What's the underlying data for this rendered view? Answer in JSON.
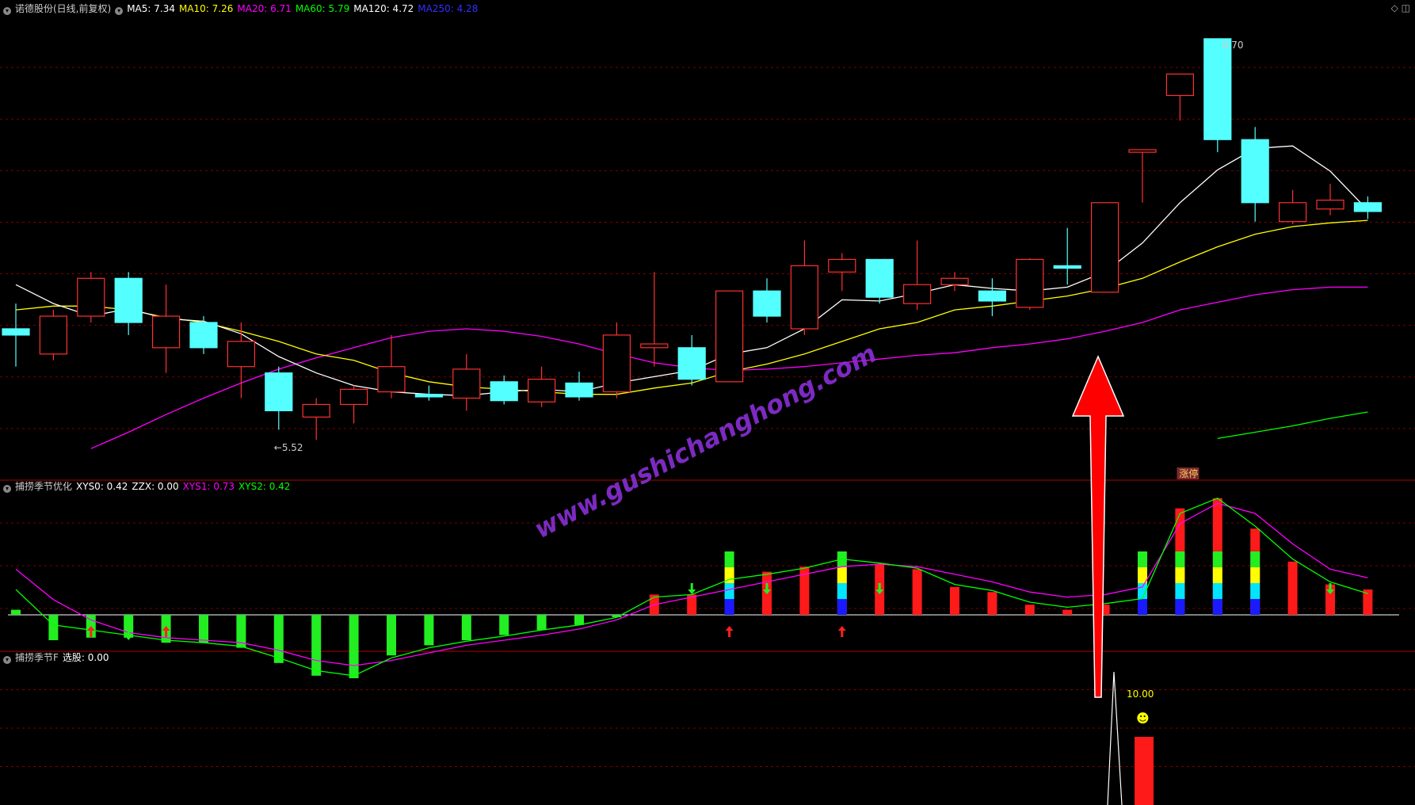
{
  "colors": {
    "bg": "#000000",
    "grid": "#7a0000",
    "up": "#ff3030",
    "down": "#54ffff",
    "ma5": "#ffffff",
    "ma10": "#ffff00",
    "ma20": "#ff00ff",
    "ma60": "#00ff00",
    "ma120": "#ffffff",
    "ma250": "#3030ff",
    "watermark": "#8a2fd6",
    "arrow": "#ff0000"
  },
  "panel1": {
    "title": "诺德股份(日线,前复权)",
    "ma": [
      {
        "label": "MA5: 7.34",
        "color": "#ffffff"
      },
      {
        "label": "MA10: 7.26",
        "color": "#ffff00"
      },
      {
        "label": "MA20: 6.71",
        "color": "#ff00ff"
      },
      {
        "label": "MA60: 5.79",
        "color": "#00ff00"
      },
      {
        "label": "MA120: 4.72",
        "color": "#ffffff"
      },
      {
        "label": "MA250: 4.28",
        "color": "#3030ff"
      }
    ],
    "max_label": "8.70",
    "min_label": "5.52",
    "zt_label": "涨停"
  },
  "panel2": {
    "title": "捕捞季节优化",
    "items": [
      {
        "label": "XYS0: 0.42",
        "color": "#ffffff"
      },
      {
        "label": "ZZX: 0.00",
        "color": "#ffffff"
      },
      {
        "label": "XYS1: 0.73",
        "color": "#ff00ff"
      },
      {
        "label": "XYS2: 0.42",
        "color": "#00ff00"
      }
    ]
  },
  "panel3": {
    "title": "捕捞季节F",
    "items": [
      {
        "label": "选股: 0.00",
        "color": "#ffffff"
      }
    ],
    "value_label": "10.00",
    "smile": "☻"
  },
  "watermark": "www.gushichanghong.com",
  "icons": [
    "collapse-toggle-icon",
    "diamond-icon",
    "window-icon"
  ],
  "chart_data": {
    "type": "candlestick",
    "candles": [
      {
        "o": 6.4,
        "c": 6.35,
        "h": 6.6,
        "l": 6.1
      },
      {
        "o": 6.2,
        "c": 6.5,
        "h": 6.55,
        "l": 6.15
      },
      {
        "o": 6.5,
        "c": 6.8,
        "h": 6.85,
        "l": 6.45
      },
      {
        "o": 6.8,
        "c": 6.45,
        "h": 6.85,
        "l": 6.35
      },
      {
        "o": 6.25,
        "c": 6.5,
        "h": 6.75,
        "l": 6.05
      },
      {
        "o": 6.45,
        "c": 6.25,
        "h": 6.5,
        "l": 6.2
      },
      {
        "o": 6.1,
        "c": 6.3,
        "h": 6.45,
        "l": 5.85
      },
      {
        "o": 6.05,
        "c": 5.75,
        "h": 6.1,
        "l": 5.6
      },
      {
        "o": 5.7,
        "c": 5.8,
        "h": 5.85,
        "l": 5.52
      },
      {
        "o": 5.8,
        "c": 5.92,
        "h": 5.95,
        "l": 5.65
      },
      {
        "o": 5.9,
        "c": 6.1,
        "h": 6.35,
        "l": 5.85
      },
      {
        "o": 5.88,
        "c": 5.86,
        "h": 5.95,
        "l": 5.83
      },
      {
        "o": 5.85,
        "c": 6.08,
        "h": 6.2,
        "l": 5.75
      },
      {
        "o": 5.98,
        "c": 5.83,
        "h": 6.03,
        "l": 5.8
      },
      {
        "o": 5.82,
        "c": 6.0,
        "h": 6.1,
        "l": 5.78
      },
      {
        "o": 5.97,
        "c": 5.86,
        "h": 6.06,
        "l": 5.83
      },
      {
        "o": 5.9,
        "c": 6.35,
        "h": 6.45,
        "l": 5.85
      },
      {
        "o": 6.25,
        "c": 6.28,
        "h": 6.85,
        "l": 6.1
      },
      {
        "o": 6.25,
        "c": 6.0,
        "h": 6.35,
        "l": 5.95
      },
      {
        "o": 5.98,
        "c": 6.7,
        "h": 6.7,
        "l": 5.98
      },
      {
        "o": 6.7,
        "c": 6.5,
        "h": 6.8,
        "l": 6.45
      },
      {
        "o": 6.4,
        "c": 6.9,
        "h": 7.1,
        "l": 6.35
      },
      {
        "o": 6.85,
        "c": 6.95,
        "h": 7.0,
        "l": 6.7
      },
      {
        "o": 6.95,
        "c": 6.65,
        "h": 6.95,
        "l": 6.6
      },
      {
        "o": 6.6,
        "c": 6.75,
        "h": 7.1,
        "l": 6.55
      },
      {
        "o": 6.75,
        "c": 6.8,
        "h": 6.85,
        "l": 6.7
      },
      {
        "o": 6.7,
        "c": 6.62,
        "h": 6.8,
        "l": 6.5
      },
      {
        "o": 6.57,
        "c": 6.95,
        "h": 6.96,
        "l": 6.55
      },
      {
        "o": 6.9,
        "c": 6.88,
        "h": 7.2,
        "l": 6.75
      },
      {
        "o": 6.69,
        "c": 7.4,
        "h": 7.4,
        "l": 6.69
      },
      {
        "o": 7.8,
        "c": 7.82,
        "h": 7.82,
        "l": 7.4
      },
      {
        "o": 8.25,
        "c": 8.42,
        "h": 8.42,
        "l": 8.05
      },
      {
        "o": 8.7,
        "c": 7.9,
        "h": 8.7,
        "l": 7.8
      },
      {
        "o": 7.9,
        "c": 7.4,
        "h": 8.0,
        "l": 7.25
      },
      {
        "o": 7.25,
        "c": 7.4,
        "h": 7.5,
        "l": 7.23
      },
      {
        "o": 7.35,
        "c": 7.42,
        "h": 7.55,
        "l": 7.3
      },
      {
        "o": 7.4,
        "c": 7.33,
        "h": 7.45,
        "l": 7.27
      }
    ],
    "ma5": [
      6.75,
      6.6,
      6.5,
      6.56,
      6.48,
      6.46,
      6.36,
      6.18,
      6.05,
      5.95,
      5.9,
      5.88,
      5.87,
      5.9,
      5.92,
      5.9,
      5.97,
      6.02,
      6.07,
      6.2,
      6.25,
      6.4,
      6.63,
      6.62,
      6.68,
      6.75,
      6.72,
      6.7,
      6.73,
      6.85,
      7.08,
      7.4,
      7.66,
      7.83,
      7.85,
      7.65,
      7.34
    ],
    "ma10": [
      6.55,
      6.58,
      6.58,
      6.55,
      6.49,
      6.45,
      6.38,
      6.3,
      6.2,
      6.15,
      6.05,
      5.98,
      5.94,
      5.92,
      5.9,
      5.88,
      5.88,
      5.93,
      5.97,
      6.06,
      6.12,
      6.2,
      6.3,
      6.4,
      6.45,
      6.55,
      6.58,
      6.62,
      6.66,
      6.72,
      6.8,
      6.93,
      7.05,
      7.15,
      7.21,
      7.24,
      7.26
    ],
    "ma20": [
      null,
      null,
      5.45,
      5.58,
      5.72,
      5.85,
      5.97,
      6.08,
      6.17,
      6.25,
      6.33,
      6.38,
      6.4,
      6.38,
      6.34,
      6.28,
      6.2,
      6.13,
      6.09,
      6.07,
      6.08,
      6.1,
      6.13,
      6.16,
      6.19,
      6.21,
      6.25,
      6.28,
      6.32,
      6.38,
      6.45,
      6.55,
      6.61,
      6.67,
      6.71,
      6.73,
      6.73
    ],
    "ma60": [
      null,
      null,
      null,
      null,
      null,
      null,
      null,
      null,
      null,
      null,
      null,
      null,
      null,
      null,
      null,
      null,
      null,
      null,
      null,
      null,
      null,
      null,
      null,
      null,
      null,
      null,
      null,
      null,
      null,
      null,
      null,
      null,
      5.53,
      5.58,
      5.63,
      5.69,
      5.74
    ],
    "osc_colors": [
      "green",
      "green",
      "green",
      "green",
      "green",
      "green",
      "green",
      "green",
      "green",
      "green",
      "green",
      "green",
      "green",
      "green",
      "green",
      "green",
      "green",
      "red",
      "red",
      "red",
      "red",
      "red",
      "red",
      "red",
      "red",
      "red",
      "red",
      "red",
      "red",
      "red",
      "red",
      "red",
      "red",
      "red",
      "red",
      "red",
      "red"
    ],
    "osc": [
      0.1,
      -0.5,
      -0.45,
      -0.45,
      -0.55,
      -0.55,
      -0.65,
      -0.95,
      -1.2,
      -1.25,
      -0.8,
      -0.6,
      -0.5,
      -0.4,
      -0.3,
      -0.2,
      0.0,
      0.4,
      0.4,
      0.8,
      0.85,
      0.95,
      1.15,
      1.0,
      0.9,
      0.55,
      0.45,
      0.2,
      0.1,
      0.2,
      0.3,
      2.1,
      2.3,
      1.7,
      1.05,
      0.6,
      0.5
    ],
    "xys1": [
      0.9,
      0.3,
      -0.1,
      -0.35,
      -0.45,
      -0.5,
      -0.55,
      -0.7,
      -0.9,
      -1.0,
      -0.9,
      -0.75,
      -0.6,
      -0.5,
      -0.4,
      -0.28,
      -0.1,
      0.2,
      0.35,
      0.5,
      0.65,
      0.8,
      0.95,
      1.0,
      0.95,
      0.8,
      0.65,
      0.45,
      0.35,
      0.4,
      0.55,
      1.8,
      2.2,
      2.0,
      1.4,
      0.9,
      0.73
    ],
    "xys2": [
      0.5,
      -0.2,
      -0.3,
      -0.4,
      -0.5,
      -0.55,
      -0.62,
      -0.85,
      -1.1,
      -1.2,
      -0.85,
      -0.65,
      -0.52,
      -0.42,
      -0.3,
      -0.2,
      -0.05,
      0.35,
      0.4,
      0.7,
      0.8,
      0.92,
      1.1,
      1.02,
      0.92,
      0.6,
      0.48,
      0.25,
      0.15,
      0.22,
      0.32,
      2.0,
      2.3,
      1.75,
      1.1,
      0.65,
      0.42
    ],
    "stack_bars": [
      19,
      22,
      30,
      31,
      32,
      33
    ],
    "up_arrows": [
      2,
      4,
      19,
      22
    ],
    "down_arrows": [
      3,
      5,
      18,
      20,
      23,
      35
    ],
    "signal": [
      0,
      0,
      0,
      0,
      0,
      0,
      0,
      0,
      0,
      0,
      0,
      0,
      0,
      0,
      0,
      0,
      0,
      0,
      0,
      0,
      0,
      0,
      0,
      0,
      0,
      0,
      0,
      0,
      0,
      0,
      10,
      0,
      0,
      0,
      0,
      0,
      0
    ]
  }
}
